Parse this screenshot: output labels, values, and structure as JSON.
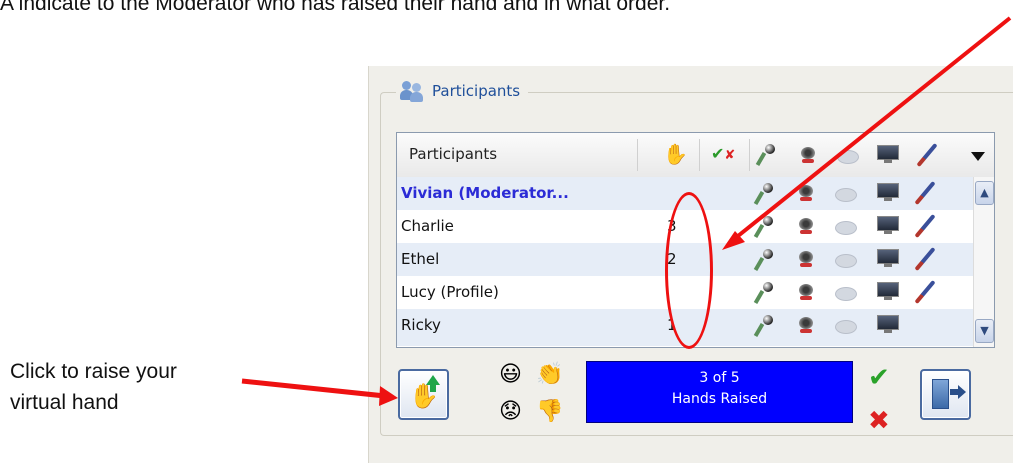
{
  "caption_top": "A indicate to the Moderator who has raised their hand and in what order.",
  "caption_side": [
    "Click to raise your",
    "virtual hand"
  ],
  "group": {
    "title": "Participants"
  },
  "table": {
    "header_label": "Participants",
    "rows": [
      {
        "name": "Vivian (Moderator...",
        "order": "",
        "moderator": true
      },
      {
        "name": "Charlie",
        "order": "3"
      },
      {
        "name": "Ethel",
        "order": "2"
      },
      {
        "name": "Lucy (Profile)",
        "order": ""
      },
      {
        "name": "Ricky",
        "order": "1"
      }
    ]
  },
  "status": {
    "count": "3 of 5",
    "label": "Hands Raised"
  },
  "colors": {
    "status_bg": "#0000ff",
    "annotation": "#ee1111",
    "moderator_text": "#2b2bd6"
  },
  "icons": [
    "people-icon",
    "hand-icon",
    "check-x-icon",
    "microphone-icon",
    "webcam-icon",
    "chat-bubble-icon",
    "monitor-icon",
    "pen-icon",
    "dropdown-icon",
    "raise-hand-icon",
    "smiley-icon",
    "applause-icon",
    "sad-face-icon",
    "thumbs-down-icon",
    "check-icon",
    "x-icon",
    "exit-icon"
  ]
}
